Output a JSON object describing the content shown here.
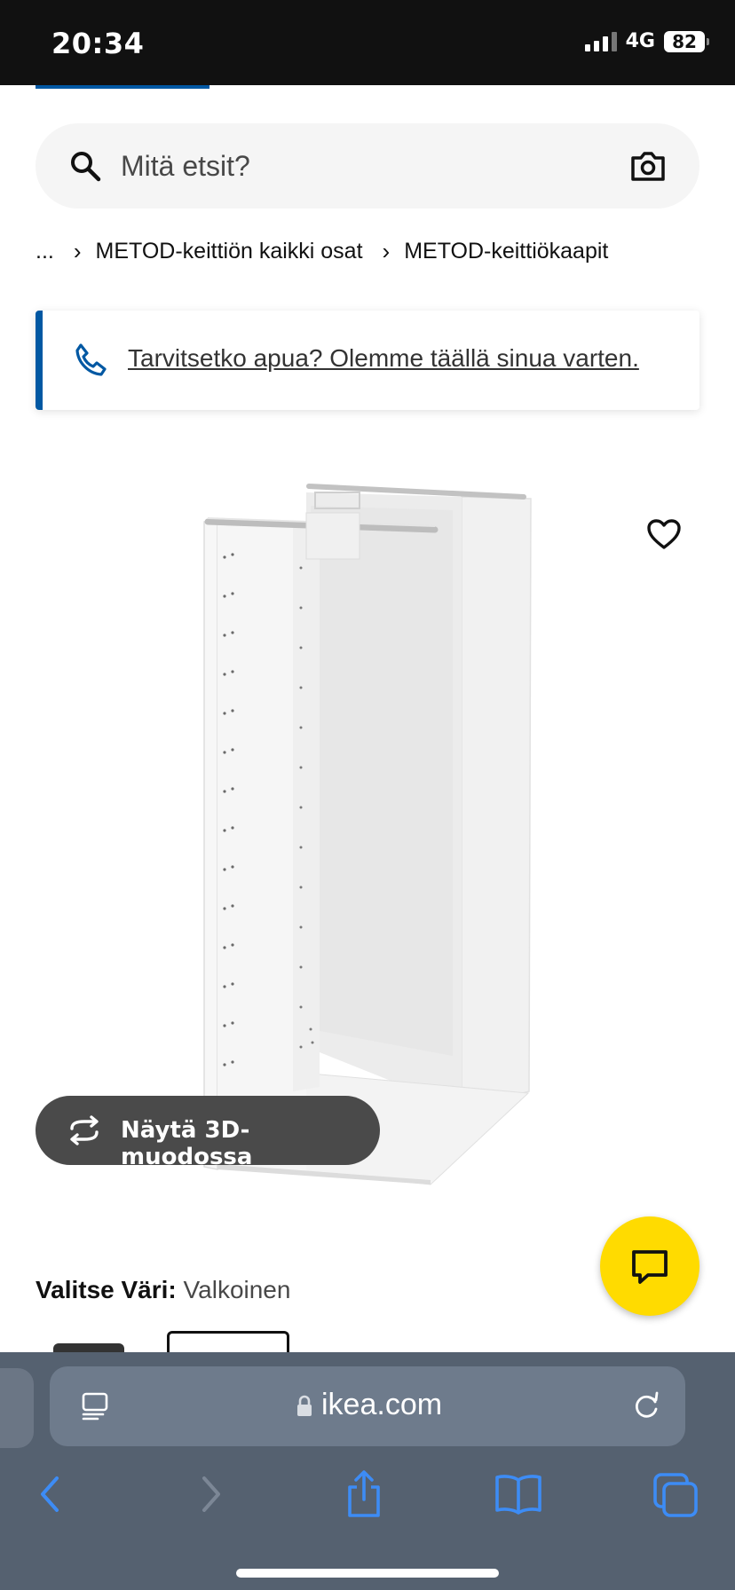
{
  "status_bar": {
    "time": "20:34",
    "network": "4G",
    "battery": "82"
  },
  "search": {
    "placeholder": "Mitä etsit?"
  },
  "breadcrumb": {
    "items": [
      "...",
      "METOD-keittiön kaikki osat",
      "METOD-keittiökaapit"
    ],
    "separator": "›"
  },
  "help_banner": {
    "text": "Tarvitsetko apua? Olemme täällä sinua varten."
  },
  "product": {
    "view_3d_label": "Näytä 3D-muodossa"
  },
  "color_selector": {
    "label": "Valitse Väri:",
    "value": "Valkoinen"
  },
  "browser": {
    "url": "ikea.com"
  },
  "colors": {
    "accent": "#0058a3",
    "chat_fab": "#ffdb00",
    "dark_button": "#4a4a4a",
    "safari_bar": "#556170"
  },
  "icons": [
    "search-icon",
    "camera-icon",
    "phone-icon",
    "heart-icon",
    "rotate-3d-icon",
    "chat-icon",
    "reader-icon",
    "lock-icon",
    "reload-icon",
    "back-icon",
    "forward-icon",
    "share-icon",
    "bookmarks-icon",
    "tabs-icon"
  ]
}
